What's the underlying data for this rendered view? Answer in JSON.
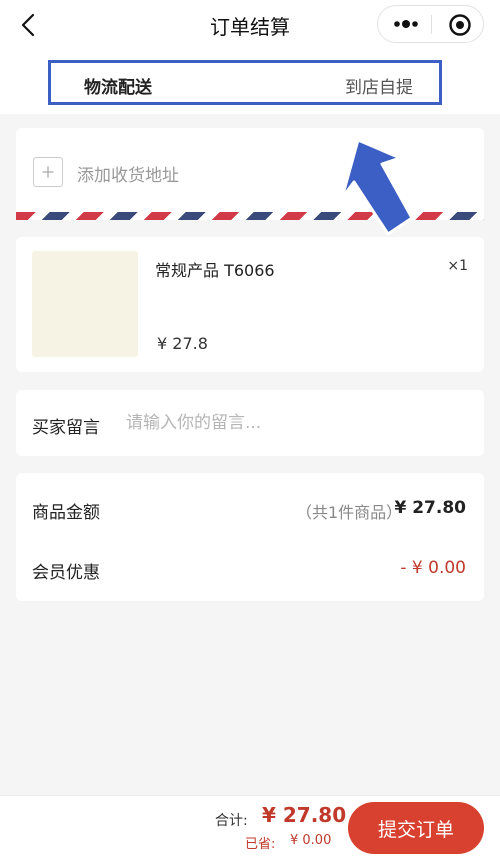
{
  "nav": {
    "title": "订单结算"
  },
  "delivery": {
    "logistics_label": "物流配送",
    "pickup_label": "到店自提"
  },
  "address": {
    "add_label": "添加收货地址"
  },
  "product": {
    "name": "常规产品 T6066",
    "quantity": "×1",
    "price": "¥ 27.8"
  },
  "message": {
    "label": "买家留言",
    "placeholder": "请输入你的留言..."
  },
  "summary": {
    "goods_label": "商品金额",
    "goods_count": "（共1件商品）",
    "goods_amount": "¥ 27.80",
    "member_label": "会员优惠",
    "member_discount": "- ¥ 0.00"
  },
  "footer": {
    "total_label": "合计:",
    "total_value": "¥ 27.80",
    "saved_label": "已省:",
    "saved_value": "¥ 0.00",
    "submit_label": "提交订单"
  },
  "colors": {
    "accent_red": "#d8412f",
    "highlight_blue": "#3b5fc4"
  },
  "icons": [
    "back-arrow-icon",
    "more-dots-icon",
    "target-icon",
    "plus-icon",
    "annotation-arrow-icon"
  ]
}
